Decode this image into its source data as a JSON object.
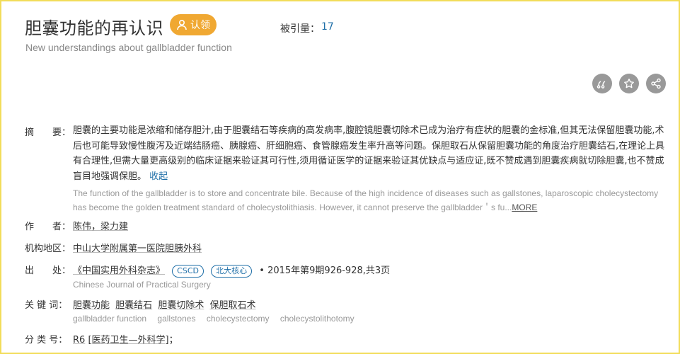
{
  "title": "胆囊功能的再认识",
  "claim_label": "认领",
  "cited_label": "被引量：",
  "cited_count": "17",
  "subtitle_en": "New understandings about gallbladder function",
  "actions": {
    "cite_icon": "quote-icon",
    "favorite_icon": "star-icon",
    "share_icon": "share-icon"
  },
  "abstract": {
    "label": "摘　　要：",
    "cn": "胆囊的主要功能是浓缩和储存胆汁,由于胆囊结石等疾病的高发病率,腹腔镜胆囊切除术已成为治疗有症状的胆囊的金标准,但其无法保留胆囊功能,术后也可能导致慢性腹泻及近端结肠癌、胰腺癌、肝细胞癌、食管腺癌发生率升高等问题。保胆取石从保留胆囊功能的角度治疗胆囊结石,在理论上具有合理性,但需大量更高级别的临床证据来验证其可行性,须用循证医学的证据来验证其优缺点与适应证,既不赞成遇到胆囊疾病就切除胆囊,也不赞成盲目地强调保胆。",
    "collapse": "收起",
    "en": "The function of the gallbladder is to store and concentrate bile. Because of the high incidence of diseases such as gallstones, laparoscopic cholecystectomy has become the golden treatment standard of cholecystolithiasis. However, it cannot preserve the gallbladder＇s fu...",
    "more": "MORE"
  },
  "authors": {
    "label": "作　　者：",
    "value": "陈伟，梁力建"
  },
  "institution": {
    "label": "机构地区：",
    "value": "中山大学附属第一医院胆胰外科"
  },
  "source": {
    "label": "出　　处：",
    "journal": "《中国实用外科杂志》",
    "tags": [
      "CSCD",
      "北大核心"
    ],
    "issue": "•  2015年第9期926-928,共3页",
    "journal_en": "Chinese Journal of Practical Surgery"
  },
  "keywords": {
    "label": "关 键 词：",
    "cn": [
      "胆囊功能",
      "胆囊结石",
      "胆囊切除术",
      "保胆取石术"
    ],
    "en": [
      "gallbladder function",
      "gallstones",
      "cholecystectomy",
      "cholecystolithotomy"
    ]
  },
  "classification": {
    "label": "分 类 号：",
    "code": "R6",
    "category": "[医药卫生—外科学]",
    "suffix": "；"
  }
}
